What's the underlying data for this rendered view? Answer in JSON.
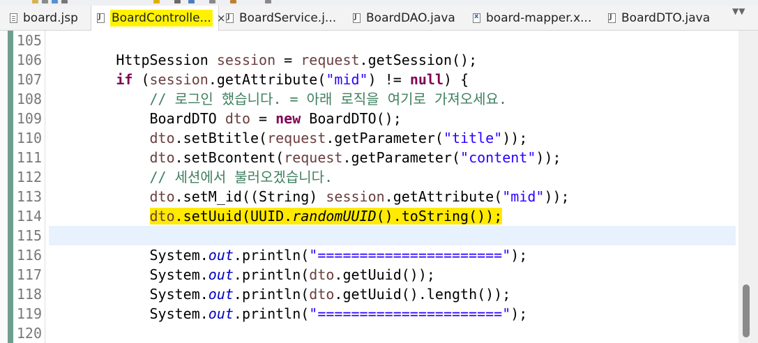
{
  "tabs": [
    {
      "label": "board.jsp",
      "icon": "jsp-file-icon",
      "active": false
    },
    {
      "label": "BoardControlle...",
      "icon": "java-file-icon",
      "active": true,
      "close": "×"
    },
    {
      "label": "BoardService.j...",
      "icon": "java-file-icon",
      "active": false
    },
    {
      "label": "BoardDAO.java",
      "icon": "java-file-icon",
      "active": false
    },
    {
      "label": "board-mapper.x...",
      "icon": "xml-file-icon",
      "active": false
    },
    {
      "label": "BoardDTO.java",
      "icon": "java-file-icon",
      "active": false
    }
  ],
  "editor": {
    "current_line": 115,
    "highlighted_line": 114,
    "lines": [
      {
        "num": "105",
        "tokens": []
      },
      {
        "num": "106",
        "tokens": [
          {
            "t": "        HttpSession "
          },
          {
            "t": "session",
            "c": "v"
          },
          {
            "t": " = "
          },
          {
            "t": "request",
            "c": "v"
          },
          {
            "t": ".getSession();"
          }
        ]
      },
      {
        "num": "107",
        "tokens": [
          {
            "t": "        "
          },
          {
            "t": "if",
            "c": "k"
          },
          {
            "t": " ("
          },
          {
            "t": "session",
            "c": "v"
          },
          {
            "t": ".getAttribute("
          },
          {
            "t": "\"mid\"",
            "c": "s"
          },
          {
            "t": ") != "
          },
          {
            "t": "null",
            "c": "k"
          },
          {
            "t": ") {"
          }
        ]
      },
      {
        "num": "108",
        "tokens": [
          {
            "t": "            "
          },
          {
            "t": "// 로그인 했습니다. = 아래 로직을 여기로 가져오세요.",
            "c": "c"
          }
        ]
      },
      {
        "num": "109",
        "tokens": [
          {
            "t": "            BoardDTO "
          },
          {
            "t": "dto",
            "c": "v"
          },
          {
            "t": " = "
          },
          {
            "t": "new",
            "c": "k"
          },
          {
            "t": " BoardDTO();"
          }
        ]
      },
      {
        "num": "110",
        "tokens": [
          {
            "t": "            "
          },
          {
            "t": "dto",
            "c": "v"
          },
          {
            "t": ".setBtitle("
          },
          {
            "t": "request",
            "c": "v"
          },
          {
            "t": ".getParameter("
          },
          {
            "t": "\"title\"",
            "c": "s"
          },
          {
            "t": "));"
          }
        ]
      },
      {
        "num": "111",
        "tokens": [
          {
            "t": "            "
          },
          {
            "t": "dto",
            "c": "v"
          },
          {
            "t": ".setBcontent("
          },
          {
            "t": "request",
            "c": "v"
          },
          {
            "t": ".getParameter("
          },
          {
            "t": "\"content\"",
            "c": "s"
          },
          {
            "t": "));"
          }
        ]
      },
      {
        "num": "112",
        "tokens": [
          {
            "t": "            "
          },
          {
            "t": "// 세션에서 불러오겠습니다.",
            "c": "c"
          }
        ]
      },
      {
        "num": "113",
        "tokens": [
          {
            "t": "            "
          },
          {
            "t": "dto",
            "c": "v"
          },
          {
            "t": ".setM_id((String) "
          },
          {
            "t": "session",
            "c": "v"
          },
          {
            "t": ".getAttribute("
          },
          {
            "t": "\"mid\"",
            "c": "s"
          },
          {
            "t": "));"
          }
        ]
      },
      {
        "num": "114",
        "tokens": [
          {
            "t": "            "
          },
          {
            "t": "dto",
            "c": "v hl"
          },
          {
            "t": ".setUuid(UUID.",
            "c": "hl"
          },
          {
            "t": "randomUUID",
            "c": "sm hl"
          },
          {
            "t": "().toString());",
            "c": "hl"
          }
        ]
      },
      {
        "num": "115",
        "tokens": []
      },
      {
        "num": "116",
        "tokens": [
          {
            "t": "            System."
          },
          {
            "t": "out",
            "c": "f"
          },
          {
            "t": ".println("
          },
          {
            "t": "\"======================\"",
            "c": "s"
          },
          {
            "t": ");"
          }
        ]
      },
      {
        "num": "117",
        "tokens": [
          {
            "t": "            System."
          },
          {
            "t": "out",
            "c": "f"
          },
          {
            "t": ".println("
          },
          {
            "t": "dto",
            "c": "v"
          },
          {
            "t": ".getUuid());"
          }
        ]
      },
      {
        "num": "118",
        "tokens": [
          {
            "t": "            System."
          },
          {
            "t": "out",
            "c": "f"
          },
          {
            "t": ".println("
          },
          {
            "t": "dto",
            "c": "v"
          },
          {
            "t": ".getUuid().length());"
          }
        ]
      },
      {
        "num": "119",
        "tokens": [
          {
            "t": "            System."
          },
          {
            "t": "out",
            "c": "f"
          },
          {
            "t": ".println("
          },
          {
            "t": "\"======================\"",
            "c": "s"
          },
          {
            "t": ");"
          }
        ]
      },
      {
        "num": "120",
        "tokens": []
      }
    ]
  },
  "colors": {
    "keyword": "#7f0055",
    "string": "#2a00ff",
    "comment": "#3f7f5f",
    "static_field": "#0000c0",
    "local_variable": "#6a3e3e",
    "highlight": "#ffea00",
    "current_line_bg": "#e8f2fe"
  }
}
